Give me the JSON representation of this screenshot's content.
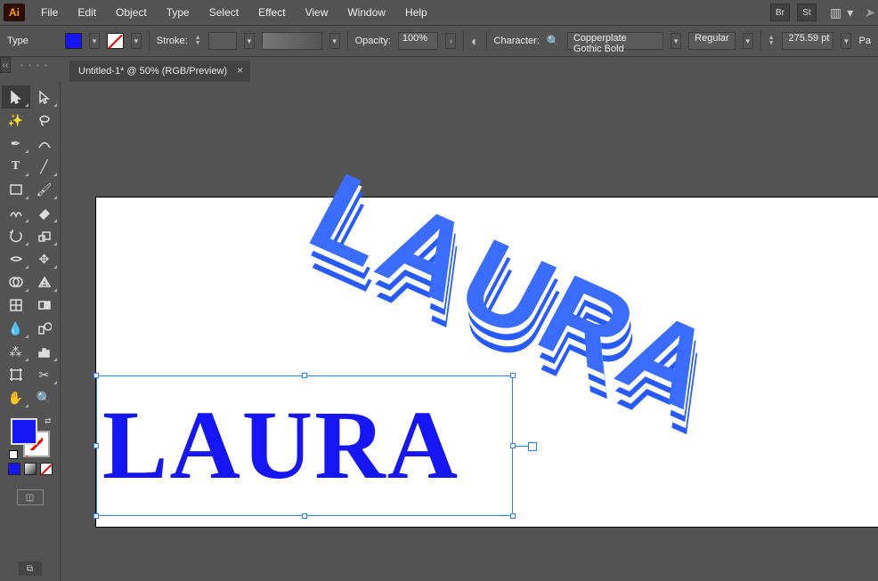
{
  "app": {
    "logo_text": "Ai"
  },
  "menu": {
    "file": "File",
    "edit": "Edit",
    "object": "Object",
    "type": "Type",
    "select": "Select",
    "effect": "Effect",
    "view": "View",
    "window": "Window",
    "help": "Help"
  },
  "topicons": {
    "bridge": "Br",
    "stock": "St"
  },
  "options": {
    "tool_name": "Type",
    "stroke_label": "Stroke:",
    "opacity_label": "Opacity:",
    "opacity_value": "100%",
    "character_label": "Character:",
    "font_name": "Copperplate Gothic Bold",
    "font_style": "Regular",
    "font_size": "275.59 pt",
    "paragraph_cut": "Pa",
    "fill_color": "#1616f4"
  },
  "doc": {
    "tab_title": "Untitled-1* @ 50% (RGB/Preview)",
    "close_glyph": "×"
  },
  "canvas": {
    "text_3d": "LAURA",
    "text_flat": "LAURA"
  },
  "lefthandle": {
    "chevrons": "‹‹",
    "dots": "• • • •"
  }
}
